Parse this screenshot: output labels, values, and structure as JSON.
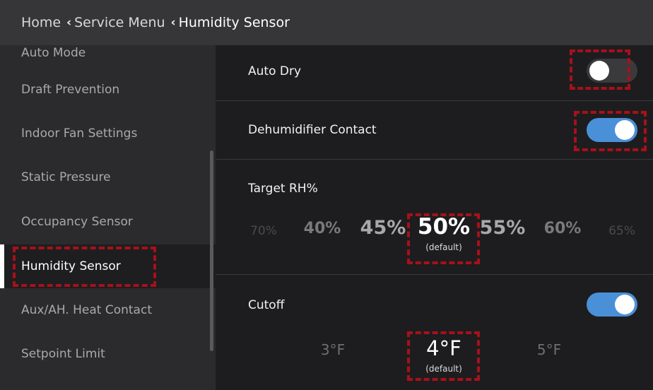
{
  "breadcrumb": {
    "home": "Home",
    "service_menu": "Service Menu",
    "current": "Humidity Sensor"
  },
  "sidebar": {
    "items": [
      {
        "label": "Auto Mode"
      },
      {
        "label": "Draft Prevention"
      },
      {
        "label": "Indoor Fan Settings"
      },
      {
        "label": "Static Pressure"
      },
      {
        "label": "Occupancy Sensor"
      },
      {
        "label": "Humidity Sensor",
        "active": true
      },
      {
        "label": "Aux/AH. Heat Contact"
      },
      {
        "label": "Setpoint Limit"
      }
    ]
  },
  "main": {
    "auto_dry": {
      "label": "Auto Dry",
      "on": false
    },
    "dehumidifier_contact": {
      "label": "Dehumidifier Contact",
      "on": true
    },
    "target_rh": {
      "label": "Target RH%",
      "options": [
        "70%",
        "40%",
        "45%",
        "50%",
        "55%",
        "60%",
        "65%"
      ],
      "selected": "50%",
      "selected_note": "(default)"
    },
    "cutoff": {
      "label": "Cutoff",
      "on": true,
      "options": [
        "3°F",
        "4°F",
        "5°F"
      ],
      "selected": "4°F",
      "selected_note": "(default)"
    }
  },
  "colors": {
    "accent": "#4a90d9",
    "highlight": "#a8101b",
    "header_bg": "#363638",
    "sidebar_bg": "#2b2b2d",
    "main_bg": "#1d1d1f"
  }
}
